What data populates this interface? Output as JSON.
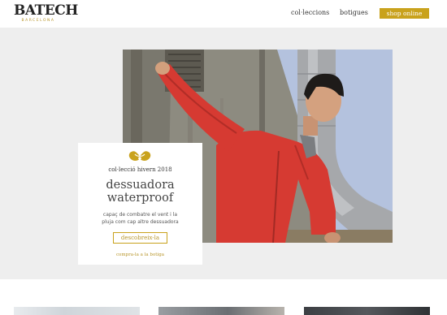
{
  "header": {
    "logo_main": "BATECH",
    "logo_sub": "BARCELONA",
    "nav": [
      "col·leccions",
      "botigues"
    ],
    "shop_label": "shop online"
  },
  "hero": {
    "card": {
      "kicker": "col·lecció hivern 2018",
      "title_line1": "dessuadora",
      "title_line2": "waterproof",
      "desc_line1": "capaç de combatre el vent i la",
      "desc_line2": "pluja com cap altre dessuadora",
      "button_label": "descobreix-la",
      "link_label": "compra-la a la botiga",
      "emblem_icon": "gold-emblem-icon"
    },
    "photo_icon": "hero-photo"
  },
  "colors": {
    "accent": "#c9a21c",
    "hero_bg": "#eeeeee",
    "jacket": "#d63a32"
  }
}
